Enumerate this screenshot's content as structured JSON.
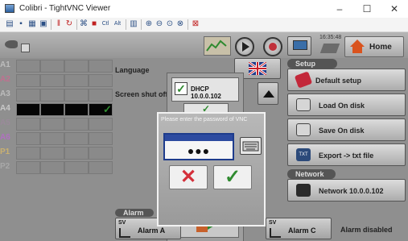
{
  "window": {
    "title": "Colibri - TightVNC Viewer",
    "minimize": "–",
    "maximize": "☐",
    "close": "✕"
  },
  "toolbar": {
    "icons": [
      "new-connection-icon",
      "save-icon",
      "options-icon",
      "info-icon",
      "pause-icon",
      "refresh-icon",
      "ctrl-alt-del-icon",
      "ctrl-icon",
      "alt-icon",
      "clipboard-icon",
      "zoom-in-icon",
      "zoom-out-icon",
      "zoom-100-icon",
      "zoom-fit-icon",
      "fullscreen-icon"
    ],
    "ctrl_label": "Ctl",
    "alt_label": "Alt"
  },
  "hmi": {
    "clock": "16:35:48",
    "home_label": "Home",
    "channels": [
      "A1",
      "A2",
      "A3",
      "A4",
      "A5",
      "A6",
      "P1",
      "P2"
    ],
    "left_labels": {
      "language": "Language",
      "screen_shutoff": "Screen shut off :"
    },
    "dhcp": {
      "label": "DHCP 10.0.0.102",
      "checked": true
    },
    "setup": {
      "header": "Setup",
      "items": [
        "Default setup",
        "Load On disk",
        "Save On disk",
        "Export -> txt file"
      ]
    },
    "network": {
      "header": "Network",
      "address": "Network 10.0.0.102"
    },
    "alarm": {
      "header": "Alarm",
      "items": [
        "Alarm A",
        "Alarm C"
      ],
      "status": "Alarm disabled",
      "sv_label": "SV"
    },
    "colors": {
      "accent_green": "#2f8a2f",
      "cancel_red": "#d42f3a",
      "dialog_blue": "#1e3c8c"
    }
  },
  "password_dialog": {
    "prompt": "Please enter the password of VNC",
    "masked_value": "●●●",
    "cancel_glyph": "✕",
    "ok_glyph": "✓"
  }
}
